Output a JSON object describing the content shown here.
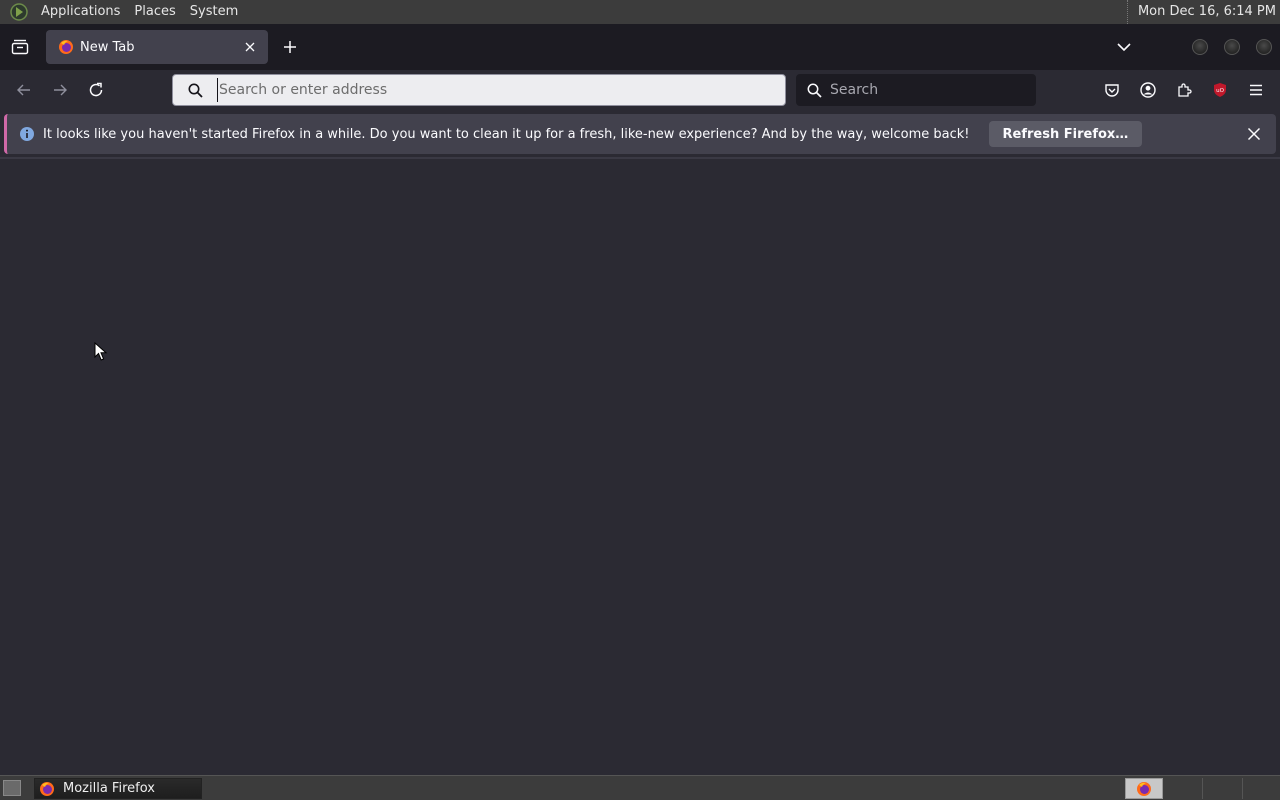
{
  "panel": {
    "menus": [
      "Applications",
      "Places",
      "System"
    ],
    "clock": "Mon Dec 16,  6:14 PM"
  },
  "tab": {
    "title": "New Tab"
  },
  "urlbar": {
    "placeholder": "Search or enter address",
    "value": ""
  },
  "searchbar": {
    "placeholder": "Search"
  },
  "notification": {
    "message": "It looks like you haven't started Firefox in a while. Do you want to clean it up for a fresh, like-new experience? And by the way, welcome back!",
    "button_label": "Refresh Firefox…"
  },
  "taskbar": {
    "window_title": "Mozilla Firefox"
  },
  "icons": {
    "tab_list": "tab-list-icon",
    "new_tab": "plus-icon",
    "back": "back-arrow-icon",
    "forward": "forward-arrow-icon",
    "reload": "reload-icon",
    "pocket": "pocket-icon",
    "account": "account-icon",
    "extensions": "extensions-icon",
    "ublock": "ublock-origin-icon",
    "menu": "hamburger-menu-icon",
    "info": "info-icon",
    "close": "close-icon"
  },
  "colors": {
    "browser_bg": "#2b2a33",
    "tabstrip_bg": "#1c1b22",
    "notification_accent": "#d069a8",
    "ublock_red": "#c0182b",
    "info_blue": "#80a8e0"
  }
}
